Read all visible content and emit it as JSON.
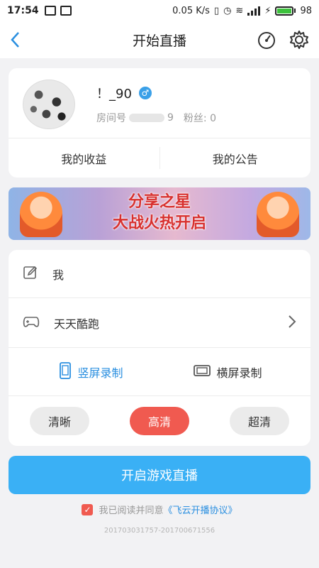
{
  "status_bar": {
    "time": "17:54",
    "net_speed": "0.05 K/s",
    "battery": "98",
    "battery_level": 0.98
  },
  "header": {
    "title": "开始直播"
  },
  "profile": {
    "username": "！_90",
    "gender_symbol": "♂",
    "room_label": "房间号",
    "room_suffix": "9",
    "fans": "粉丝: 0"
  },
  "profile_tabs": {
    "earnings": "我的收益",
    "announcement": "我的公告"
  },
  "banner": {
    "text_line1": "分享之星",
    "text_line2": "大战火热开启"
  },
  "settings": {
    "title_value": "我",
    "game_name": "天天酷跑",
    "portrait_label": "竖屏录制",
    "landscape_label": "横屏录制",
    "quality": [
      "清晰",
      "高清",
      "超清"
    ],
    "selected_quality": "高清"
  },
  "start_button": "开启游戏直播",
  "agreement": {
    "text": "我已阅读并同意",
    "link": "《飞云开播协议》"
  },
  "footer": "201703031757-201700671556",
  "colors": {
    "accent_blue": "#3ab0f5",
    "active_red": "#f05a50",
    "link_blue": "#2a8fe0"
  }
}
